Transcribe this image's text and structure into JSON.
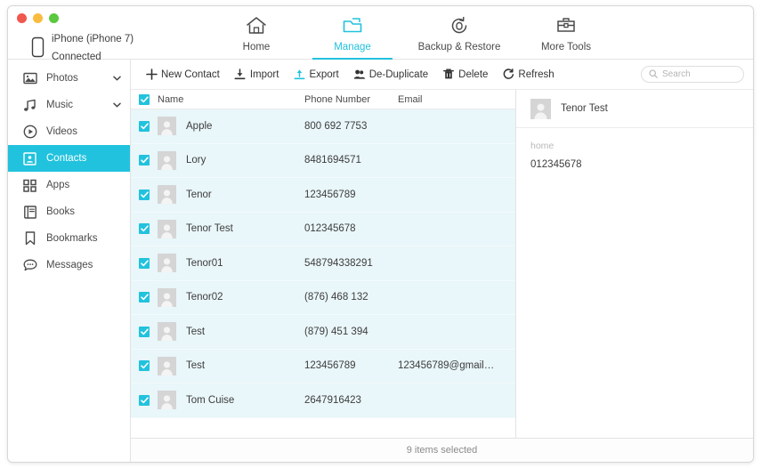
{
  "window": {
    "traffic_lights": [
      {
        "name": "close",
        "color": "#f0584f"
      },
      {
        "name": "minimize",
        "color": "#f9bc3f"
      },
      {
        "name": "zoom",
        "color": "#5bc83f"
      }
    ]
  },
  "device": {
    "name": "iPhone (iPhone 7)",
    "status": "Connected",
    "icon": "phone-icon"
  },
  "nav": {
    "tabs": [
      {
        "label": "Home",
        "icon": "home-icon",
        "active": false
      },
      {
        "label": "Manage",
        "icon": "folder-icon",
        "active": true
      },
      {
        "label": "Backup & Restore",
        "icon": "restore-icon",
        "active": false
      },
      {
        "label": "More Tools",
        "icon": "toolbox-icon",
        "active": false
      }
    ],
    "accent": "#21c2de"
  },
  "sidebar": {
    "items": [
      {
        "label": "Photos",
        "icon": "photos-icon",
        "chevron": true,
        "selected": false
      },
      {
        "label": "Music",
        "icon": "music-icon",
        "chevron": true,
        "selected": false
      },
      {
        "label": "Videos",
        "icon": "videos-icon",
        "chevron": false,
        "selected": false
      },
      {
        "label": "Contacts",
        "icon": "contacts-icon",
        "chevron": false,
        "selected": true
      },
      {
        "label": "Apps",
        "icon": "apps-icon",
        "chevron": false,
        "selected": false
      },
      {
        "label": "Books",
        "icon": "books-icon",
        "chevron": false,
        "selected": false
      },
      {
        "label": "Bookmarks",
        "icon": "bookmarks-icon",
        "chevron": false,
        "selected": false
      },
      {
        "label": "Messages",
        "icon": "messages-icon",
        "chevron": false,
        "selected": false
      }
    ]
  },
  "toolbar": {
    "actions": [
      {
        "label": "New Contact",
        "icon": "plus-icon"
      },
      {
        "label": "Import",
        "icon": "import-icon"
      },
      {
        "label": "Export",
        "icon": "export-icon"
      },
      {
        "label": "De-Duplicate",
        "icon": "deduplicate-icon"
      },
      {
        "label": "Delete",
        "icon": "trash-icon"
      },
      {
        "label": "Refresh",
        "icon": "refresh-icon"
      }
    ]
  },
  "search": {
    "value": "",
    "placeholder": "Search",
    "icon": "search-icon"
  },
  "table": {
    "select_all_checked": true,
    "columns": [
      "Name",
      "Phone Number",
      "Email"
    ],
    "rows": [
      {
        "name": "Apple",
        "phone": "800 692 7753",
        "email": "",
        "checked": true
      },
      {
        "name": "Lory",
        "phone": "8481694571",
        "email": "",
        "checked": true
      },
      {
        "name": "Tenor",
        "phone": "123456789",
        "email": "",
        "checked": true
      },
      {
        "name": "Tenor Test",
        "phone": "012345678",
        "email": "",
        "checked": true
      },
      {
        "name": "Tenor01",
        "phone": "548794338291",
        "email": "",
        "checked": true
      },
      {
        "name": "Tenor02",
        "phone": "(876) 468 132",
        "email": "",
        "checked": true
      },
      {
        "name": "Test",
        "phone": "(879) 451 394",
        "email": "",
        "checked": true
      },
      {
        "name": "Test",
        "phone": "123456789",
        "email": "123456789@gmail…",
        "checked": true
      },
      {
        "name": "Tom Cuise",
        "phone": "2647916423",
        "email": "",
        "checked": true
      }
    ]
  },
  "detail": {
    "name": "Tenor Test",
    "fields": [
      {
        "label": "home",
        "value": "012345678"
      }
    ]
  },
  "status": {
    "text": "9 items selected"
  }
}
